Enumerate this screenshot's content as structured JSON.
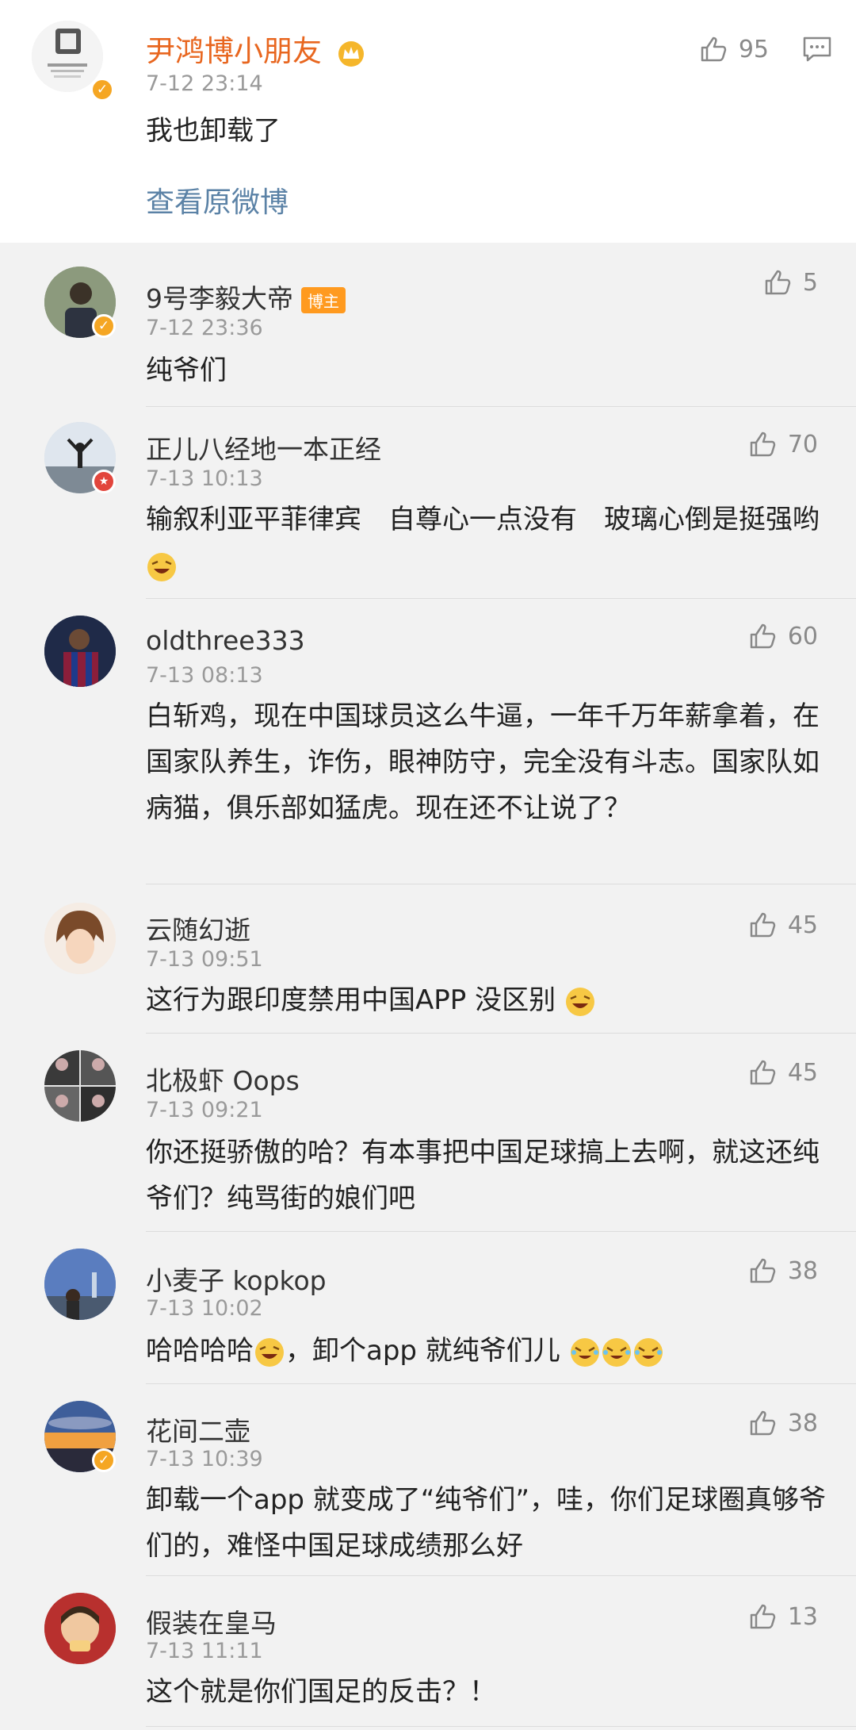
{
  "original_post": {
    "user_name": "尹鸿博小朋友",
    "time": "7-12 23:14",
    "text": "我也卸载了",
    "likes": "95",
    "view_original": "查看原微博"
  },
  "comments": [
    {
      "name": "9号李毅大帝",
      "tag": "博主",
      "time": "7-12 23:36",
      "text": "纯爷们",
      "likes": "5"
    },
    {
      "name": "正儿八经地一本正经",
      "time": "7-13 10:13",
      "text": "输叙利亚平菲律宾　自尊心一点没有　玻璃心倒是挺强哟",
      "likes": "70"
    },
    {
      "name": "oldthree333",
      "time": "7-13 08:13",
      "text": "白斩鸡，现在中国球员这么牛逼，一年千万年薪拿着，在国家队养生，诈伤，眼神防守，完全没有斗志。国家队如病猫，俱乐部如猛虎。现在还不让说了？",
      "likes": "60"
    },
    {
      "name": "云随幻逝",
      "time": "7-13 09:51",
      "text": "这行为跟印度禁用中国APP 没区别",
      "likes": "45"
    },
    {
      "name": "北极虾 Oops",
      "time": "7-13 09:21",
      "text": "你还挺骄傲的哈？有本事把中国足球搞上去啊，就这还纯爷们？纯骂街的娘们吧",
      "likes": "45"
    },
    {
      "name": "小麦子 kopkop",
      "time": "7-13 10:02",
      "text_a": "哈哈哈哈",
      "text_b": "，卸个app 就纯爷们儿 ",
      "likes": "38"
    },
    {
      "name": "花间二壶",
      "time": "7-13 10:39",
      "text": "卸载一个app 就变成了“纯爷们”，哇，你们足球圈真够爷们的，难怪中国足球成绩那么好",
      "likes": "38"
    },
    {
      "name": "假装在皇马",
      "time": "7-13 11:11",
      "text": "这个就是你们国足的反击？！",
      "likes": "13"
    }
  ],
  "icons": {
    "like": "thumbs-up-icon",
    "comment": "comment-icon",
    "verified": "verified-badge-icon",
    "crown": "crown-icon"
  }
}
